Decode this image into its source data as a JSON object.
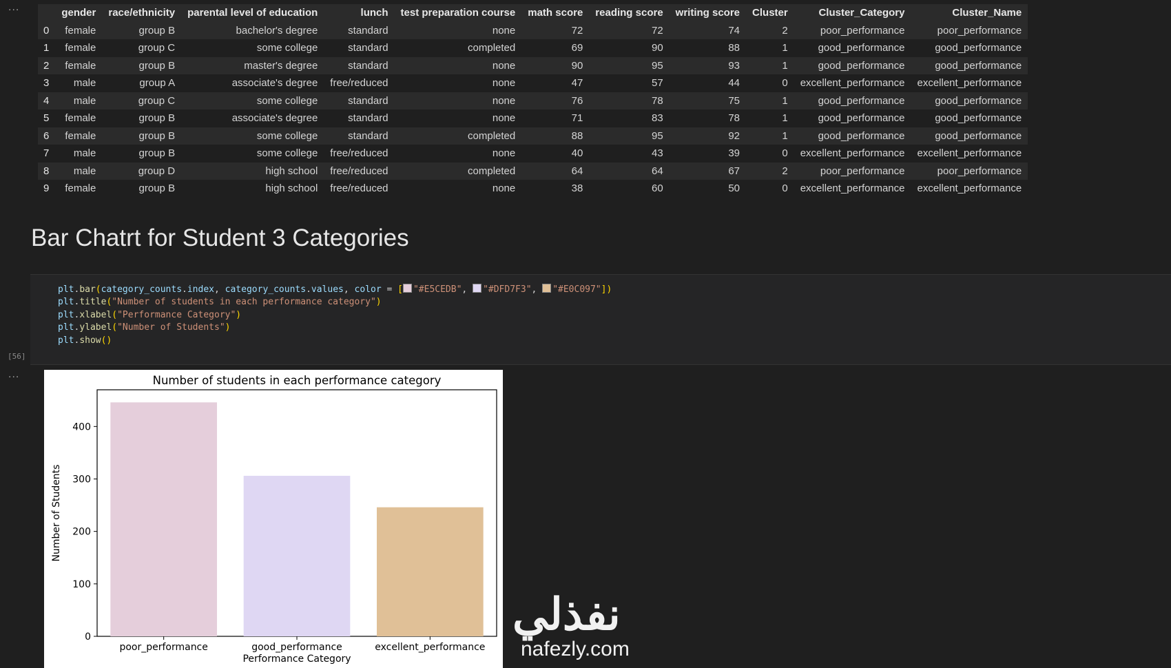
{
  "df_output": {
    "columns": [
      "",
      "gender",
      "race/ethnicity",
      "parental level of education",
      "lunch",
      "test preparation course",
      "math score",
      "reading score",
      "writing score",
      "Cluster",
      "Cluster_Category",
      "Cluster_Name"
    ],
    "rows": [
      [
        "0",
        "female",
        "group B",
        "bachelor's degree",
        "standard",
        "none",
        "72",
        "72",
        "74",
        "2",
        "poor_performance",
        "poor_performance"
      ],
      [
        "1",
        "female",
        "group C",
        "some college",
        "standard",
        "completed",
        "69",
        "90",
        "88",
        "1",
        "good_performance",
        "good_performance"
      ],
      [
        "2",
        "female",
        "group B",
        "master's degree",
        "standard",
        "none",
        "90",
        "95",
        "93",
        "1",
        "good_performance",
        "good_performance"
      ],
      [
        "3",
        "male",
        "group A",
        "associate's degree",
        "free/reduced",
        "none",
        "47",
        "57",
        "44",
        "0",
        "excellent_performance",
        "excellent_performance"
      ],
      [
        "4",
        "male",
        "group C",
        "some college",
        "standard",
        "none",
        "76",
        "78",
        "75",
        "1",
        "good_performance",
        "good_performance"
      ],
      [
        "5",
        "female",
        "group B",
        "associate's degree",
        "standard",
        "none",
        "71",
        "83",
        "78",
        "1",
        "good_performance",
        "good_performance"
      ],
      [
        "6",
        "female",
        "group B",
        "some college",
        "standard",
        "completed",
        "88",
        "95",
        "92",
        "1",
        "good_performance",
        "good_performance"
      ],
      [
        "7",
        "male",
        "group B",
        "some college",
        "free/reduced",
        "none",
        "40",
        "43",
        "39",
        "0",
        "excellent_performance",
        "excellent_performance"
      ],
      [
        "8",
        "male",
        "group D",
        "high school",
        "free/reduced",
        "completed",
        "64",
        "64",
        "67",
        "2",
        "poor_performance",
        "poor_performance"
      ],
      [
        "9",
        "female",
        "group B",
        "high school",
        "free/reduced",
        "none",
        "38",
        "60",
        "50",
        "0",
        "excellent_performance",
        "excellent_performance"
      ]
    ]
  },
  "ellipsis": "...",
  "markdown_heading": "Bar Chatrt for Student 3 Categories",
  "code_cell": {
    "execution_count": "[56]",
    "line1": {
      "a": "plt",
      "b": ".",
      "c": "bar",
      "d": "(",
      "e": "category_counts",
      "f": ".",
      "g": "index",
      "h": ", ",
      "i": "category_counts",
      "j": ".",
      "k": "values",
      "l": ", ",
      "m": "color",
      "n": " = ",
      "o": "[",
      "c1": "\"#E5CEDB\"",
      "sep1": ", ",
      "c2": "\"#DFD7F3\"",
      "sep2": ", ",
      "c3": "\"#E0C097\"",
      "p": "])"
    },
    "line2": {
      "a": "plt",
      "b": ".",
      "c": "title",
      "d": "(",
      "s": "\"Number of students in each performance category\"",
      "e": ")"
    },
    "line3": {
      "a": "plt",
      "b": ".",
      "c": "xlabel",
      "d": "(",
      "s": "\"Performance Category\"",
      "e": ")"
    },
    "line4": {
      "a": "plt",
      "b": ".",
      "c": "ylabel",
      "d": "(",
      "s": "\"Number of Students\"",
      "e": ")"
    },
    "line5": {
      "a": "plt",
      "b": ".",
      "c": "show",
      "d": "()"
    },
    "swatch_colors": [
      "#E5CEDB",
      "#DFD7F3",
      "#E0C097"
    ]
  },
  "chart_data": {
    "type": "bar",
    "title": "Number of students in each performance category",
    "xlabel": "Performance Category",
    "ylabel": "Number of Students",
    "categories": [
      "poor_performance",
      "good_performance",
      "excellent_performance"
    ],
    "values": [
      446,
      306,
      246
    ],
    "colors": [
      "#E5CEDB",
      "#DFD7F3",
      "#E0C097"
    ],
    "ylim": [
      0,
      470
    ],
    "yticks": [
      0,
      100,
      200,
      300,
      400
    ],
    "grid": false
  },
  "watermark": {
    "arabic": "نفذلي",
    "latin": "nafezly.com"
  }
}
